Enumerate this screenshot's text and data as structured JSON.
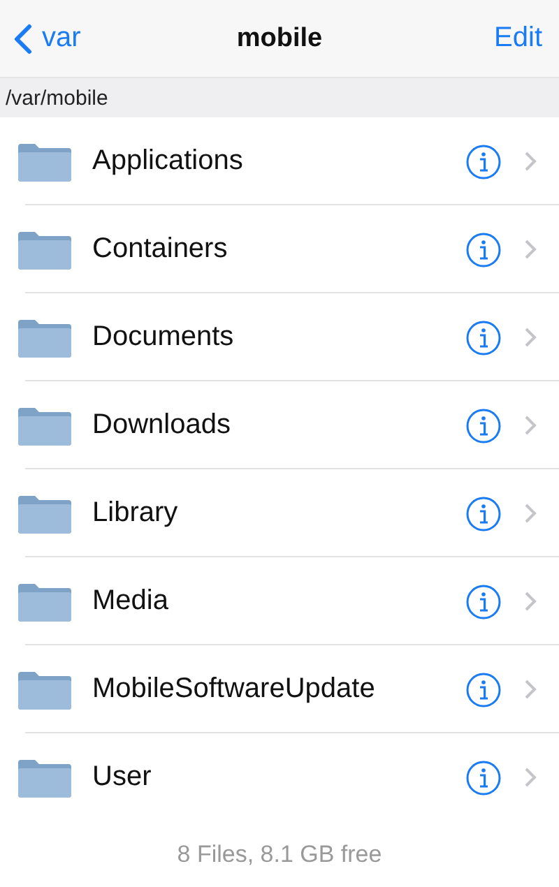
{
  "nav": {
    "back": "var",
    "title": "mobile",
    "action": "Edit"
  },
  "path": "/var/mobile",
  "items": [
    {
      "name": "Applications"
    },
    {
      "name": "Containers"
    },
    {
      "name": "Documents"
    },
    {
      "name": "Downloads"
    },
    {
      "name": "Library"
    },
    {
      "name": "Media"
    },
    {
      "name": "MobileSoftwareUpdate"
    },
    {
      "name": "User"
    }
  ],
  "footer": "8 Files, 8.1 GB free"
}
